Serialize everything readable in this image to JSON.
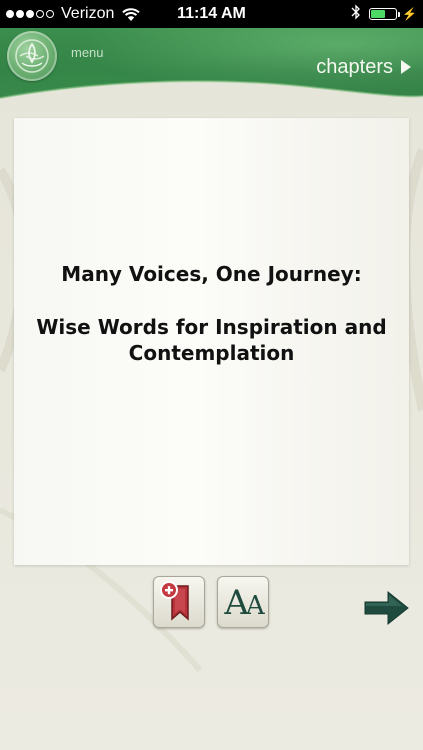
{
  "status_bar": {
    "carrier": "Verizon",
    "time": "11:14 AM",
    "signal_bars_filled": 3,
    "signal_bars_total": 5,
    "battery_level": 0.6
  },
  "header": {
    "menu_label": "menu",
    "chapters_label": "chapters"
  },
  "page": {
    "title": "Many Voices, One Journey:",
    "subtitle": "Wise Words for Inspiration and Contemplation"
  },
  "toolbar": {
    "font_size_glyph": "AA"
  },
  "icons": {
    "logo": "lotus-logo-icon",
    "chapters": "chevron-right-icon",
    "bookmark": "add-bookmark-icon",
    "font_size": "font-size-icon",
    "next": "arrow-right-icon",
    "wifi": "wifi-icon",
    "bluetooth": "bluetooth-icon",
    "battery": "battery-icon"
  },
  "colors": {
    "header_green": "#2f7a42",
    "arrow_teal": "#1f4b3e",
    "bookmark_red": "#b8323a",
    "battery_green": "#4cd964"
  }
}
